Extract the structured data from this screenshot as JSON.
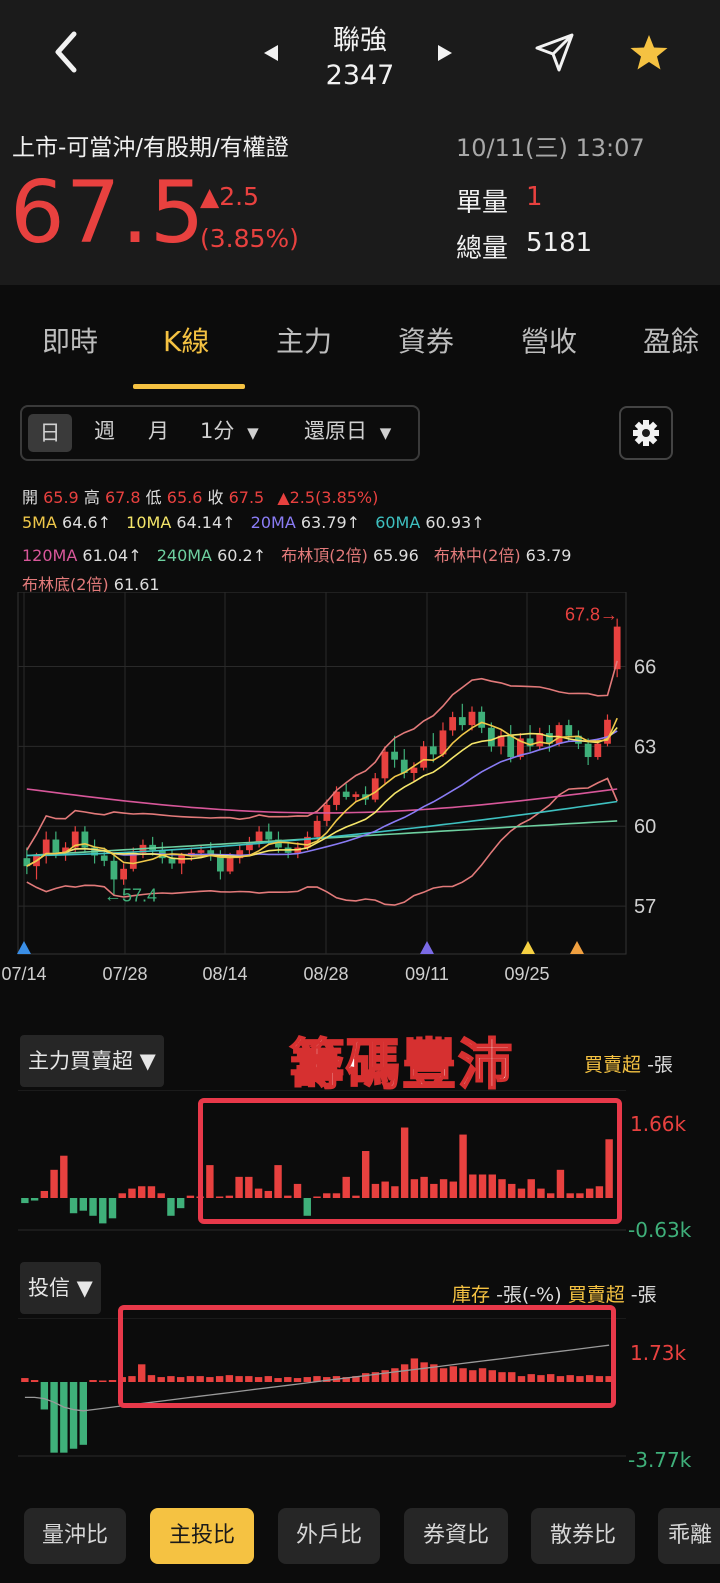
{
  "header": {
    "stock_name": "聯強",
    "stock_code": "2347",
    "tags": "上市-可當沖/有股期/有權證",
    "datetime": "10/11(三) 13:07",
    "price": "67.5",
    "change": "▲2.5",
    "change_pct": "(3.85%)",
    "unit_volume_label": "單量",
    "unit_volume": "1",
    "total_volume_label": "總量",
    "total_volume": "5181"
  },
  "tabs": [
    "即時",
    "K線",
    "主力",
    "資券",
    "營收",
    "盈餘"
  ],
  "period_bar": {
    "day": "日",
    "week": "週",
    "month": "月",
    "minute": "1分",
    "restore": "還原日"
  },
  "info": {
    "open_label": "開",
    "open": "65.9",
    "high_label": "高",
    "high": "67.8",
    "low_label": "低",
    "low": "65.6",
    "close_label": "收",
    "close": "67.5",
    "change": "▲2.5(3.85%)",
    "ma5_label": "5MA",
    "ma5": "64.6↑",
    "ma10_label": "10MA",
    "ma10": "64.14↑",
    "ma20_label": "20MA",
    "ma20": "63.79↑",
    "ma60_label": "60MA",
    "ma60": "60.93↑",
    "ma120_label": "120MA",
    "ma120": "61.04↑",
    "ma240_label": "240MA",
    "ma240": "60.2↑",
    "boll_top_label": "布林頂(2倍)",
    "boll_top": "65.96",
    "boll_mid_label": "布林中(2倍)",
    "boll_mid": "63.79",
    "boll_bot_label": "布林底(2倍)",
    "boll_bot": "61.61",
    "max_label": "67.8→",
    "min_label": "←57.4"
  },
  "colors": {
    "up": "#e8413f",
    "down": "#3fb07a",
    "ma5": "#f0c84a",
    "ma10": "#f5e66a",
    "ma20": "#8a7cf5",
    "ma60": "#3ec0c0",
    "ma120": "#d8579a",
    "ma240": "#6ed0a0",
    "boll": "#e27a7a",
    "accent": "#f5c242"
  },
  "chart_data": [
    {
      "type": "candlestick",
      "title": "",
      "x_ticks": [
        "07/14",
        "07/28",
        "08/14",
        "08/28",
        "09/11",
        "09/25"
      ],
      "y_ticks": [
        57,
        60,
        63,
        66
      ],
      "ylim": [
        55.5,
        68.5
      ],
      "max_marker": 67.8,
      "min_marker": 57.4,
      "candles": [
        {
          "o": 58.8,
          "h": 59.2,
          "l": 58.2,
          "c": 58.5
        },
        {
          "o": 58.5,
          "h": 59.0,
          "l": 58.0,
          "c": 58.9
        },
        {
          "o": 58.9,
          "h": 59.8,
          "l": 58.6,
          "c": 59.5
        },
        {
          "o": 59.5,
          "h": 59.8,
          "l": 58.8,
          "c": 59.0
        },
        {
          "o": 59.0,
          "h": 59.4,
          "l": 58.7,
          "c": 59.2
        },
        {
          "o": 59.2,
          "h": 60.0,
          "l": 59.0,
          "c": 59.8
        },
        {
          "o": 59.8,
          "h": 60.0,
          "l": 59.0,
          "c": 59.2
        },
        {
          "o": 59.2,
          "h": 59.5,
          "l": 58.6,
          "c": 58.9
        },
        {
          "o": 58.9,
          "h": 59.2,
          "l": 58.5,
          "c": 58.7
        },
        {
          "o": 58.7,
          "h": 58.9,
          "l": 57.4,
          "c": 58.0
        },
        {
          "o": 58.0,
          "h": 58.6,
          "l": 57.8,
          "c": 58.4
        },
        {
          "o": 58.4,
          "h": 59.2,
          "l": 58.3,
          "c": 59.0
        },
        {
          "o": 59.0,
          "h": 59.5,
          "l": 58.8,
          "c": 59.3
        },
        {
          "o": 59.3,
          "h": 59.6,
          "l": 58.9,
          "c": 59.1
        },
        {
          "o": 59.1,
          "h": 59.4,
          "l": 58.6,
          "c": 58.8
        },
        {
          "o": 58.8,
          "h": 59.1,
          "l": 58.4,
          "c": 58.6
        },
        {
          "o": 58.6,
          "h": 59.0,
          "l": 58.2,
          "c": 58.9
        },
        {
          "o": 58.9,
          "h": 59.2,
          "l": 58.7,
          "c": 59.0
        },
        {
          "o": 59.0,
          "h": 59.3,
          "l": 58.8,
          "c": 59.1
        },
        {
          "o": 59.1,
          "h": 59.4,
          "l": 58.7,
          "c": 58.9
        },
        {
          "o": 58.9,
          "h": 59.1,
          "l": 58.0,
          "c": 58.3
        },
        {
          "o": 58.3,
          "h": 59.0,
          "l": 58.2,
          "c": 58.8
        },
        {
          "o": 58.8,
          "h": 59.3,
          "l": 58.6,
          "c": 59.1
        },
        {
          "o": 59.1,
          "h": 59.6,
          "l": 58.9,
          "c": 59.4
        },
        {
          "o": 59.4,
          "h": 60.0,
          "l": 59.2,
          "c": 59.8
        },
        {
          "o": 59.8,
          "h": 60.1,
          "l": 59.3,
          "c": 59.5
        },
        {
          "o": 59.5,
          "h": 59.8,
          "l": 59.0,
          "c": 59.2
        },
        {
          "o": 59.2,
          "h": 59.4,
          "l": 58.8,
          "c": 59.0
        },
        {
          "o": 59.0,
          "h": 59.4,
          "l": 58.8,
          "c": 59.2
        },
        {
          "o": 59.2,
          "h": 59.8,
          "l": 59.1,
          "c": 59.6
        },
        {
          "o": 59.6,
          "h": 60.4,
          "l": 59.5,
          "c": 60.2
        },
        {
          "o": 60.2,
          "h": 61.0,
          "l": 60.0,
          "c": 60.8
        },
        {
          "o": 60.8,
          "h": 61.5,
          "l": 60.6,
          "c": 61.3
        },
        {
          "o": 61.3,
          "h": 61.6,
          "l": 61.0,
          "c": 61.1
        },
        {
          "o": 61.1,
          "h": 61.3,
          "l": 60.9,
          "c": 61.2
        },
        {
          "o": 61.2,
          "h": 61.5,
          "l": 60.8,
          "c": 61.0
        },
        {
          "o": 61.0,
          "h": 62.0,
          "l": 60.9,
          "c": 61.8
        },
        {
          "o": 61.8,
          "h": 63.0,
          "l": 61.6,
          "c": 62.8
        },
        {
          "o": 62.8,
          "h": 63.4,
          "l": 62.2,
          "c": 62.5
        },
        {
          "o": 62.5,
          "h": 62.9,
          "l": 61.8,
          "c": 62.0
        },
        {
          "o": 62.0,
          "h": 62.4,
          "l": 61.7,
          "c": 62.2
        },
        {
          "o": 62.2,
          "h": 63.2,
          "l": 62.1,
          "c": 63.0
        },
        {
          "o": 63.0,
          "h": 63.5,
          "l": 62.4,
          "c": 62.7
        },
        {
          "o": 62.7,
          "h": 63.9,
          "l": 62.6,
          "c": 63.6
        },
        {
          "o": 63.6,
          "h": 64.3,
          "l": 63.4,
          "c": 64.1
        },
        {
          "o": 64.1,
          "h": 64.6,
          "l": 63.6,
          "c": 63.8
        },
        {
          "o": 63.8,
          "h": 64.5,
          "l": 63.6,
          "c": 64.3
        },
        {
          "o": 64.3,
          "h": 64.5,
          "l": 63.5,
          "c": 63.7
        },
        {
          "o": 63.7,
          "h": 63.9,
          "l": 62.8,
          "c": 63.0
        },
        {
          "o": 63.0,
          "h": 63.6,
          "l": 62.7,
          "c": 63.4
        },
        {
          "o": 63.4,
          "h": 63.8,
          "l": 62.4,
          "c": 62.6
        },
        {
          "o": 62.6,
          "h": 63.5,
          "l": 62.5,
          "c": 63.3
        },
        {
          "o": 63.3,
          "h": 63.8,
          "l": 62.8,
          "c": 63.0
        },
        {
          "o": 63.0,
          "h": 63.7,
          "l": 62.9,
          "c": 63.5
        },
        {
          "o": 63.5,
          "h": 63.8,
          "l": 62.8,
          "c": 63.1
        },
        {
          "o": 63.1,
          "h": 63.9,
          "l": 63.0,
          "c": 63.8
        },
        {
          "o": 63.8,
          "h": 64.0,
          "l": 63.2,
          "c": 63.4
        },
        {
          "o": 63.4,
          "h": 63.6,
          "l": 62.9,
          "c": 63.1
        },
        {
          "o": 63.1,
          "h": 63.3,
          "l": 62.3,
          "c": 62.6
        },
        {
          "o": 62.6,
          "h": 63.3,
          "l": 62.5,
          "c": 63.1
        },
        {
          "o": 63.1,
          "h": 64.2,
          "l": 63.0,
          "c": 64.0
        },
        {
          "o": 65.9,
          "h": 67.8,
          "l": 65.6,
          "c": 67.5
        }
      ]
    },
    {
      "type": "bar",
      "title": "主力買賣超",
      "unit_label": "-張",
      "ylim": [
        -0.63,
        1.66
      ],
      "y_ticks": [
        "1.66k",
        "-0.63k"
      ],
      "values": [
        -0.1,
        -0.05,
        0.15,
        0.6,
        0.9,
        -0.3,
        -0.25,
        -0.35,
        -0.5,
        -0.4,
        0.1,
        0.2,
        0.25,
        0.25,
        0.1,
        -0.35,
        -0.2,
        0.05,
        0.0,
        0.7,
        0.0,
        0.05,
        0.45,
        0.45,
        0.2,
        0.15,
        0.7,
        0.05,
        0.3,
        -0.35,
        0.0,
        0.1,
        0.1,
        0.45,
        0.05,
        1.0,
        0.3,
        0.35,
        0.25,
        1.5,
        0.4,
        0.45,
        0.3,
        0.4,
        0.35,
        1.35,
        0.5,
        0.5,
        0.5,
        0.4,
        0.3,
        0.2,
        0.4,
        0.2,
        0.1,
        0.6,
        0.1,
        0.1,
        0.2,
        0.25,
        1.25
      ]
    },
    {
      "type": "bar",
      "title": "投信",
      "ylim": [
        -3.77,
        1.73
      ],
      "y_ticks": [
        "1.73k",
        "-3.77k"
      ],
      "values": [
        0.2,
        0.1,
        -1.4,
        -3.6,
        -3.6,
        -3.4,
        -3.2,
        0.1,
        0.0,
        0.1,
        0.25,
        0.3,
        0.9,
        0.35,
        0.25,
        0.3,
        0.25,
        0.3,
        0.3,
        0.25,
        0.3,
        0.35,
        0.3,
        0.3,
        0.25,
        0.3,
        0.2,
        0.25,
        0.2,
        0.25,
        0.3,
        0.25,
        0.3,
        0.25,
        0.3,
        0.45,
        0.5,
        0.6,
        0.7,
        0.9,
        1.2,
        1.0,
        0.9,
        0.7,
        0.8,
        0.7,
        0.6,
        0.7,
        0.6,
        0.5,
        0.5,
        0.3,
        0.4,
        0.35,
        0.4,
        0.3,
        0.35,
        0.3,
        0.35,
        0.3,
        0.3
      ],
      "inventory_line": [
        -0.5,
        -0.5,
        -0.55,
        -0.7,
        -0.9,
        -1.0,
        -1.05,
        -1.0,
        -0.95,
        -0.9,
        -0.85,
        -0.8,
        -0.75,
        -0.7,
        -0.65,
        -0.6,
        -0.55,
        -0.5,
        -0.45,
        -0.4,
        -0.35,
        -0.3,
        -0.25,
        -0.2,
        -0.15,
        -0.1,
        -0.05,
        0.0,
        0.05,
        0.1,
        0.15,
        0.2,
        0.25,
        0.3,
        0.35,
        0.4,
        0.45,
        0.5,
        0.55,
        0.6,
        0.65,
        0.7,
        0.75,
        0.8,
        0.85,
        0.9,
        0.95,
        1.0,
        1.05,
        1.1,
        1.15,
        1.2,
        1.25,
        1.3,
        1.35,
        1.4,
        1.45,
        1.5,
        1.55,
        1.6,
        1.65
      ]
    }
  ],
  "panel1": {
    "selector": "主力買賣超 ▼",
    "legend_label": "買賣超",
    "legend_unit": "-張",
    "max": "1.66k",
    "min": "-0.63k"
  },
  "panel2": {
    "selector": "投信 ▼",
    "legend_inv": "庫存",
    "legend_inv_unit": "-張(-%)",
    "legend_buy": "買賣超",
    "legend_buy_unit": "-張",
    "max": "1.73k",
    "min": "-3.77k"
  },
  "overlay_text": "籌碼豐沛",
  "bottom_tabs": [
    "量沖比",
    "主投比",
    "外戶比",
    "券資比",
    "散券比",
    "乖離"
  ],
  "bottom_selected": 1
}
